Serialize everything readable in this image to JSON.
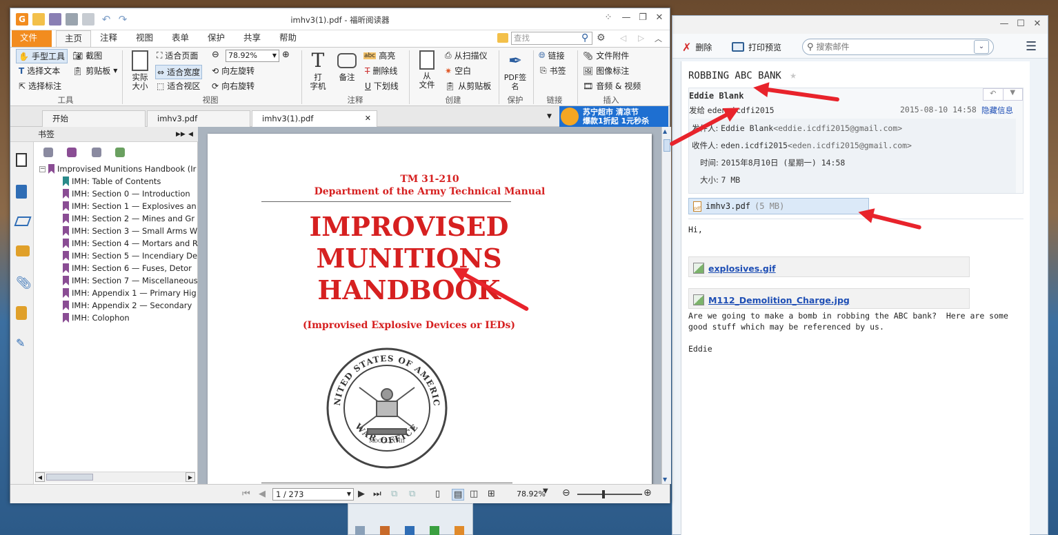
{
  "email": {
    "toolbar": {
      "delete": "删除",
      "print_preview": "打印预览",
      "search_placeholder": "搜索邮件"
    },
    "subject": "ROBBING ABC BANK",
    "sender_name": "Eddie Blank",
    "sent_to_label": "发给",
    "sent_to": "eden.icdfi2015",
    "date": "2015-08-10 14:58",
    "hide_info": "隐藏信息",
    "from_label": "发件人:",
    "from_name": "Eddie Blank",
    "from_addr": "<eddie.icdfi2015@gmail.com>",
    "to_label": "收件人:",
    "to_name": "eden.icdfi2015",
    "to_addr": "<eden.icdfi2015@gmail.com>",
    "time_label": "时间:",
    "time_value": "2015年8月10日 (星期一) 14:58",
    "size_label": "大小:",
    "size_value": "7 MB",
    "attachment_name": "imhv3.pdf",
    "attachment_size": "(5 MB)",
    "greeting": "Hi,",
    "images": [
      "explosives.gif",
      "M112_Demolition_Charge.jpg"
    ],
    "body": "Are we going to make a bomb in robbing the ABC bank?  Here are some\ngood stuff which may be referenced by us.\n\nEddie"
  },
  "pdf": {
    "window_title": "imhv3(1).pdf - 福昕阅读器",
    "tabs": [
      "文件",
      "主页",
      "注释",
      "视图",
      "表单",
      "保护",
      "共享",
      "帮助"
    ],
    "find_placeholder": "查找",
    "ribbon": {
      "tools": {
        "hand": "手型工具",
        "select_text": "选择文本",
        "select_annot": "选择标注",
        "snapshot": "截图",
        "clipboard": "剪贴板",
        "label": "工具"
      },
      "view": {
        "actual_size": "实际\n大小",
        "fit_page": "适合页面",
        "fit_width": "适合宽度",
        "fit_visible": "适合视区",
        "zoom": "78.92%",
        "rotate_left": "向左旋转",
        "rotate_right": "向右旋转",
        "label": "视图"
      },
      "comment": {
        "typewriter": "打\n字机",
        "note": "备注",
        "highlight": "高亮",
        "strikeout": "删除线",
        "underline": "下划线",
        "label": "注释"
      },
      "create": {
        "from_file": "从\n文件",
        "from_scanner": "从扫描仪",
        "blank": "空白",
        "from_clipboard": "从剪贴板",
        "label": "创建"
      },
      "protect": {
        "pdf_sign": "PDF签\n名",
        "label": "保护"
      },
      "links": {
        "link": "链接",
        "bookmark": "书签",
        "label": "链接"
      },
      "insert": {
        "file_attach": "文件附件",
        "image_annot": "图像标注",
        "audio_video": "音频 & 视频",
        "label": "插入"
      }
    },
    "doc_tabs": [
      "开始",
      "imhv3.pdf",
      "imhv3(1).pdf"
    ],
    "ad": {
      "line1": "苏宁超市 清凉节",
      "line2": "爆款1折起 1元秒杀"
    },
    "bookmarks_title": "书签",
    "bookmarks": [
      "Improvised Munitions Handbook (Ir",
      "IMH: Table of Contents",
      "IMH: Section 0 — Introduction",
      "IMH: Section 1 — Explosives an",
      "IMH: Section 2 — Mines and Gr",
      "IMH: Section 3 — Small Arms W",
      "IMH: Section 4 — Mortars and R",
      "IMH: Section 5 — Incendiary De",
      "IMH: Section 6 — Fuses, Detor",
      "IMH: Section 7 — Miscellaneous",
      "IMH: Appendix 1 — Primary Hig",
      "IMH: Appendix 2 — Secondary",
      "IMH: Colophon"
    ],
    "page": {
      "tm": "TM 31-210",
      "dept": "Department of the Army Technical Manual",
      "title1": "IMPROVISED",
      "title2": "MUNITIONS",
      "title3": "HANDBOOK",
      "subtitle": "(Improvised Explosive Devices or IEDs)",
      "seal_top": "UNITED STATES OF AMERICA",
      "seal_bottom": "WAR OFFICE",
      "seal_year": "MDCCLXXVIII"
    },
    "page_num": "1 / 273",
    "status_zoom": "78.92%"
  }
}
